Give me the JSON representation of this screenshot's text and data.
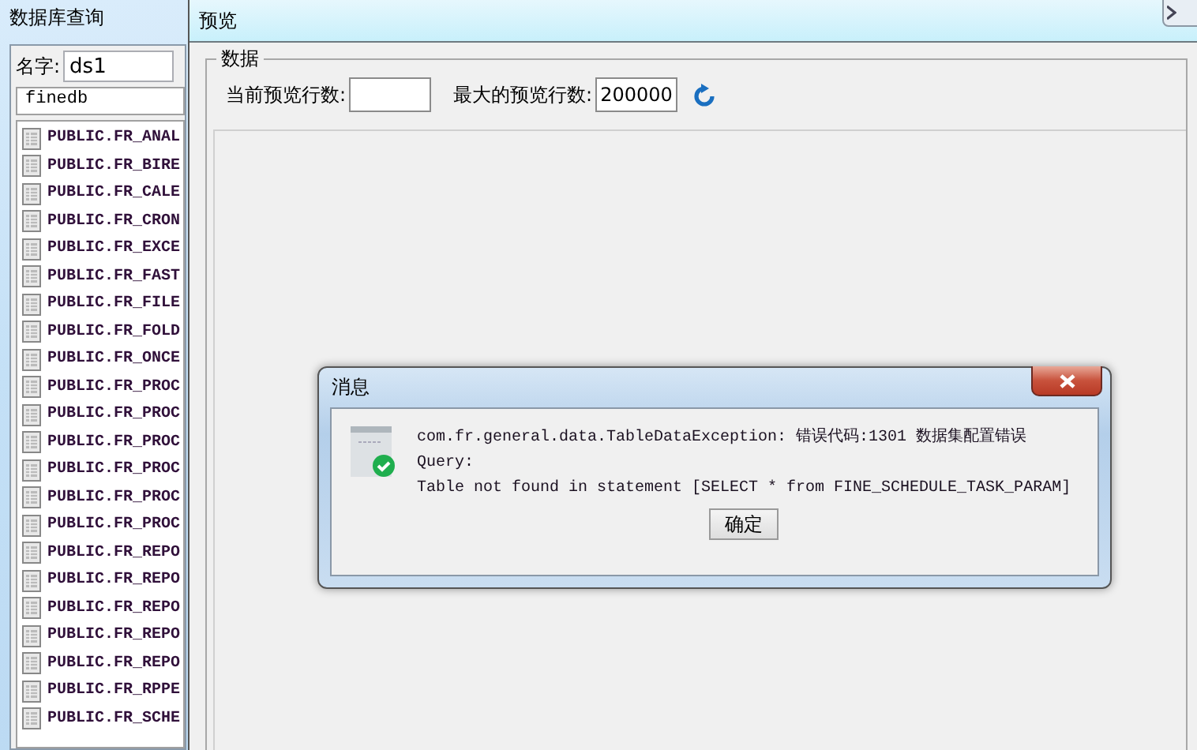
{
  "query_window": {
    "title": "数据库查询",
    "name_label": "名字:",
    "name_value": "ds1",
    "database": "finedb",
    "tables": [
      "PUBLIC.FR_ANAL",
      "PUBLIC.FR_BIRE",
      "PUBLIC.FR_CALE",
      "PUBLIC.FR_CRON",
      "PUBLIC.FR_EXCE",
      "PUBLIC.FR_FAST",
      "PUBLIC.FR_FILE",
      "PUBLIC.FR_FOLD",
      "PUBLIC.FR_ONCE",
      "PUBLIC.FR_PROC",
      "PUBLIC.FR_PROC",
      "PUBLIC.FR_PROC",
      "PUBLIC.FR_PROC",
      "PUBLIC.FR_PROC",
      "PUBLIC.FR_PROC",
      "PUBLIC.FR_REPO",
      "PUBLIC.FR_REPO",
      "PUBLIC.FR_REPO",
      "PUBLIC.FR_REPO",
      "PUBLIC.FR_REPO",
      "PUBLIC.FR_RPPE",
      "PUBLIC.FR_SCHE"
    ]
  },
  "preview_window": {
    "title": "预览",
    "group_title": "数据",
    "current_rows_label": "当前预览行数:",
    "max_rows_label": "最大的预览行数:",
    "max_rows_value": "200000"
  },
  "message_dialog": {
    "title": "消息",
    "lines": [
      "com.fr.general.data.TableDataException: 错误代码:1301 数据集配置错误",
      "Query:",
      "Table not found in statement [SELECT * from  FINE_SCHEDULE_TASK_PARAM]"
    ],
    "button": "确定"
  }
}
